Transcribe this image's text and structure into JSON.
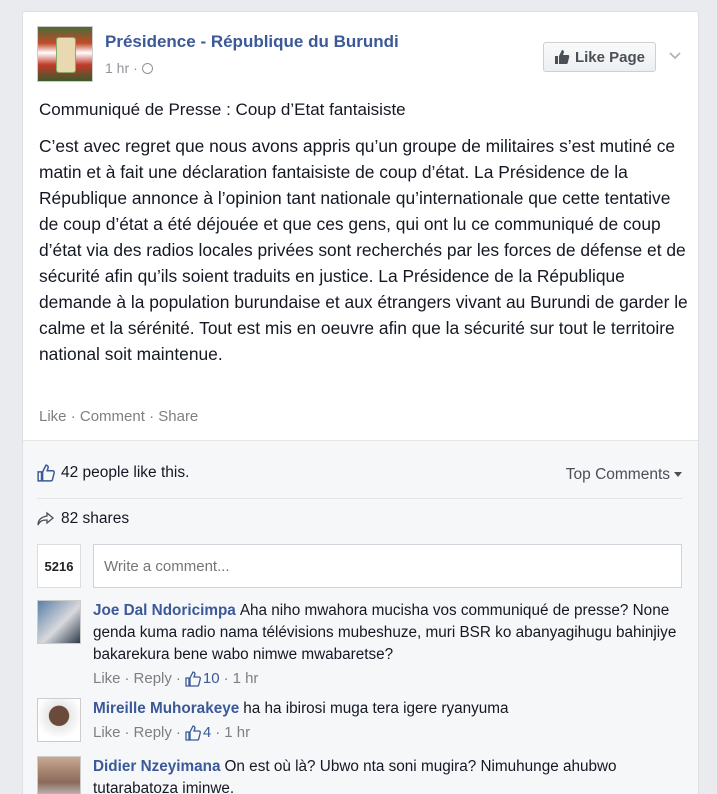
{
  "post": {
    "page_name": "Présidence - République du Burundi",
    "time": "1 hr",
    "meta_separator": "·",
    "like_page_label": "Like Page",
    "title": "Communiqué de Presse : Coup d’Etat fantaisiste",
    "body": "C’est avec regret que nous avons appris qu’un groupe de militaires s’est mutiné ce matin et à fait une déclaration fantaisiste de coup d’état. La Présidence de la République annonce à l’opinion tant nationale qu’internationale que cette tentative de coup d’état a été déjouée et que ces gens, qui ont lu ce communiqué de coup d’état via des radios locales privées sont recherchés par les forces de défense et de sécurité afin qu’ils soient traduits en justice. La Présidence de la République demande à la population burundaise et aux étrangers vivant au Burundi de garder le calme et la sérénité. Tout est mis en oeuvre afin que la sécurité sur tout le territoire national soit maintenue.",
    "actions": {
      "like": "Like",
      "comment": "Comment",
      "share": "Share",
      "dot": "·"
    }
  },
  "ufi": {
    "likes_text": "42 people like this.",
    "top_comments_label": "Top Comments",
    "shares_text": "82 shares",
    "composer_avatar_text": "5216",
    "comment_placeholder": "Write a comment..."
  },
  "comments": [
    {
      "author": "Joe Dal Ndoricimpa",
      "text": "Aha niho mwahora mucisha vos communiqué de presse? None genda kuma radio nama télévisions mubeshuze, muri BSR ko abanyagihugu bahinjiye bakarekura bene wabo nimwe mwabaretse?",
      "like": "Like",
      "reply": "Reply",
      "likes": "10",
      "time": "1 hr"
    },
    {
      "author": "Mireille Muhorakeye",
      "text": "ha ha ibirosi muga tera igere ryanyuma",
      "like": "Like",
      "reply": "Reply",
      "likes": "4",
      "time": "1 hr"
    },
    {
      "author": "Didier Nzeyimana",
      "text": "On est où là? Ubwo nta soni mugira? Nimuhunge ahubwo tutarabatoza iminwe."
    }
  ],
  "colors": {
    "link_blue": "#3b5998",
    "muted": "#7f7f7f",
    "background": "#e9ebee"
  },
  "icons": [
    "globe-icon",
    "thumb-up-icon",
    "chevron-down-icon",
    "share-arrow-icon",
    "caret-down-icon"
  ]
}
